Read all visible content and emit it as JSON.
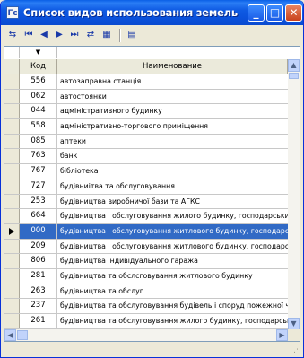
{
  "window": {
    "title": "Список видов использования земель",
    "icon_label": "Гс",
    "minimize_glyph": "_",
    "maximize_glyph": "□",
    "close_glyph": "✕"
  },
  "toolbar": {
    "buttons": [
      {
        "name": "filter-toggle-icon",
        "glyph": "⇆"
      },
      {
        "name": "first-record-icon",
        "glyph": "⏮"
      },
      {
        "name": "prev-record-icon",
        "glyph": "◀"
      },
      {
        "name": "next-record-icon",
        "glyph": "▶"
      },
      {
        "name": "last-record-icon",
        "glyph": "⏭"
      },
      {
        "name": "filter-grid-icon",
        "glyph": "⇄"
      },
      {
        "name": "table-view-icon",
        "glyph": "▦"
      },
      {
        "name": "export-icon",
        "glyph": "▤"
      }
    ]
  },
  "grid": {
    "filter_marker": "▼",
    "columns": {
      "code": "Код",
      "name": "Наименование"
    },
    "selected_index": 10,
    "rows": [
      {
        "code": "556",
        "name": "автозаправна станція"
      },
      {
        "code": "062",
        "name": "автостоянки"
      },
      {
        "code": "044",
        "name": "адміністративного будинку"
      },
      {
        "code": "558",
        "name": "адміністративно-торгового приміщення"
      },
      {
        "code": "085",
        "name": "аптеки"
      },
      {
        "code": "763",
        "name": "банк"
      },
      {
        "code": "767",
        "name": "бібліотека"
      },
      {
        "code": "727",
        "name": "будівниітва та обслуговування"
      },
      {
        "code": "253",
        "name": "будівництва виробничої бази та АГКС"
      },
      {
        "code": "664",
        "name": "будівництва і обслуговування жилого будинку, господарських б"
      },
      {
        "code": "000",
        "name": "будівництва і обслуговування житлового будинку, господарськ"
      },
      {
        "code": "209",
        "name": "будівництва і обслуговування житлового будинку, господарськ"
      },
      {
        "code": "806",
        "name": "будівництва індивідуального гаража"
      },
      {
        "code": "281",
        "name": "будівництва та обслсговування житлового будинку"
      },
      {
        "code": "263",
        "name": "будівництва та обслуг."
      },
      {
        "code": "237",
        "name": "будівництва та обслуговування будівель і споруд пожежної част"
      },
      {
        "code": "261",
        "name": "будівництва та обслуговування жилого будинку, господарськи"
      },
      {
        "code": "667",
        "name": "будівництва та обслуговування жилого будинку, господарськи"
      },
      {
        "code": "748",
        "name": "будівництва та обслуговування жилого будинку, господарськи"
      },
      {
        "code": "277",
        "name": "будівництва та обслуговування жилого будинку, господарськи"
      }
    ],
    "scroll_up": "▲",
    "scroll_down": "▼",
    "scroll_left": "◀",
    "scroll_right": "▶"
  },
  "statusbar": {
    "grip": "⋰"
  }
}
